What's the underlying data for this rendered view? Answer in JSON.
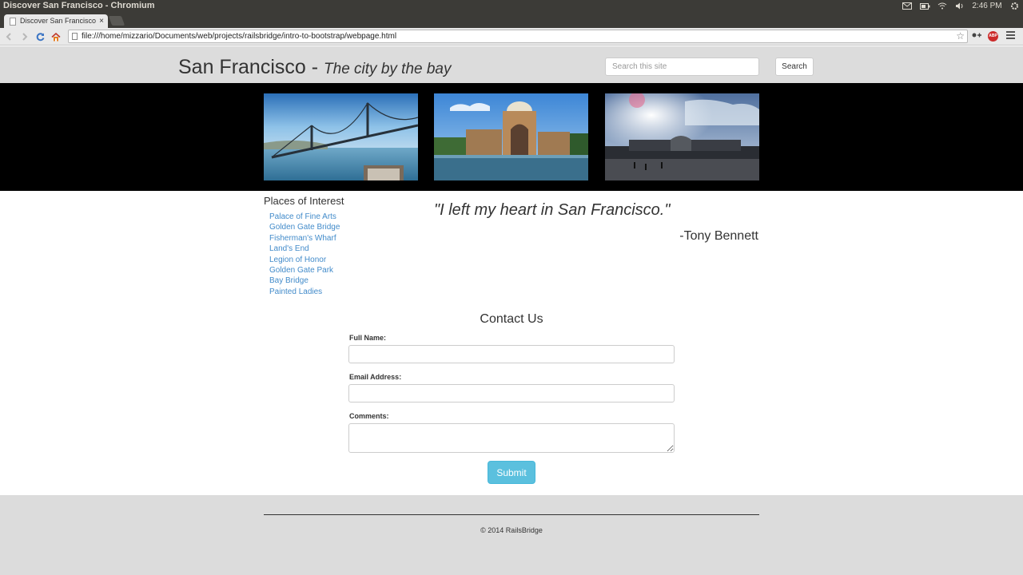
{
  "os": {
    "window_title": "Discover San Francisco - Chromium",
    "time": "2:46 PM"
  },
  "browser": {
    "tab_title": "Discover San Francisco",
    "tab_close": "×",
    "url": "file:///home/mizzario/Documents/web/projects/railsbridge/intro-to-bootstrap/webpage.html"
  },
  "header": {
    "title": "San Francisco -",
    "tagline": "The city by the bay",
    "search_placeholder": "Search this site",
    "search_button": "Search"
  },
  "photos": [
    {
      "name": "Bay Bridge"
    },
    {
      "name": "Palace of Fine Arts"
    },
    {
      "name": "Legion of Honor"
    }
  ],
  "sidebar": {
    "heading": "Places of Interest",
    "items": [
      {
        "label": "Palace of Fine Arts"
      },
      {
        "label": "Golden Gate Bridge"
      },
      {
        "label": "Fisherman's Wharf"
      },
      {
        "label": "Land's End"
      },
      {
        "label": "Legion of Honor"
      },
      {
        "label": "Golden Gate Park"
      },
      {
        "label": "Bay Bridge"
      },
      {
        "label": "Painted Ladies"
      }
    ]
  },
  "quote": {
    "text": "\"I left my heart in San Francisco.\"",
    "author": "-Tony Bennett"
  },
  "contact": {
    "title": "Contact Us",
    "name_label": "Full Name:",
    "email_label": "Email Address:",
    "comments_label": "Comments:",
    "submit_label": "Submit"
  },
  "footer": {
    "text": "© 2014 RailsBridge"
  },
  "colors": {
    "link": "#428bca",
    "submit": "#5bc0de",
    "header_bg": "#dcdcdc",
    "band_bg": "#000000"
  }
}
